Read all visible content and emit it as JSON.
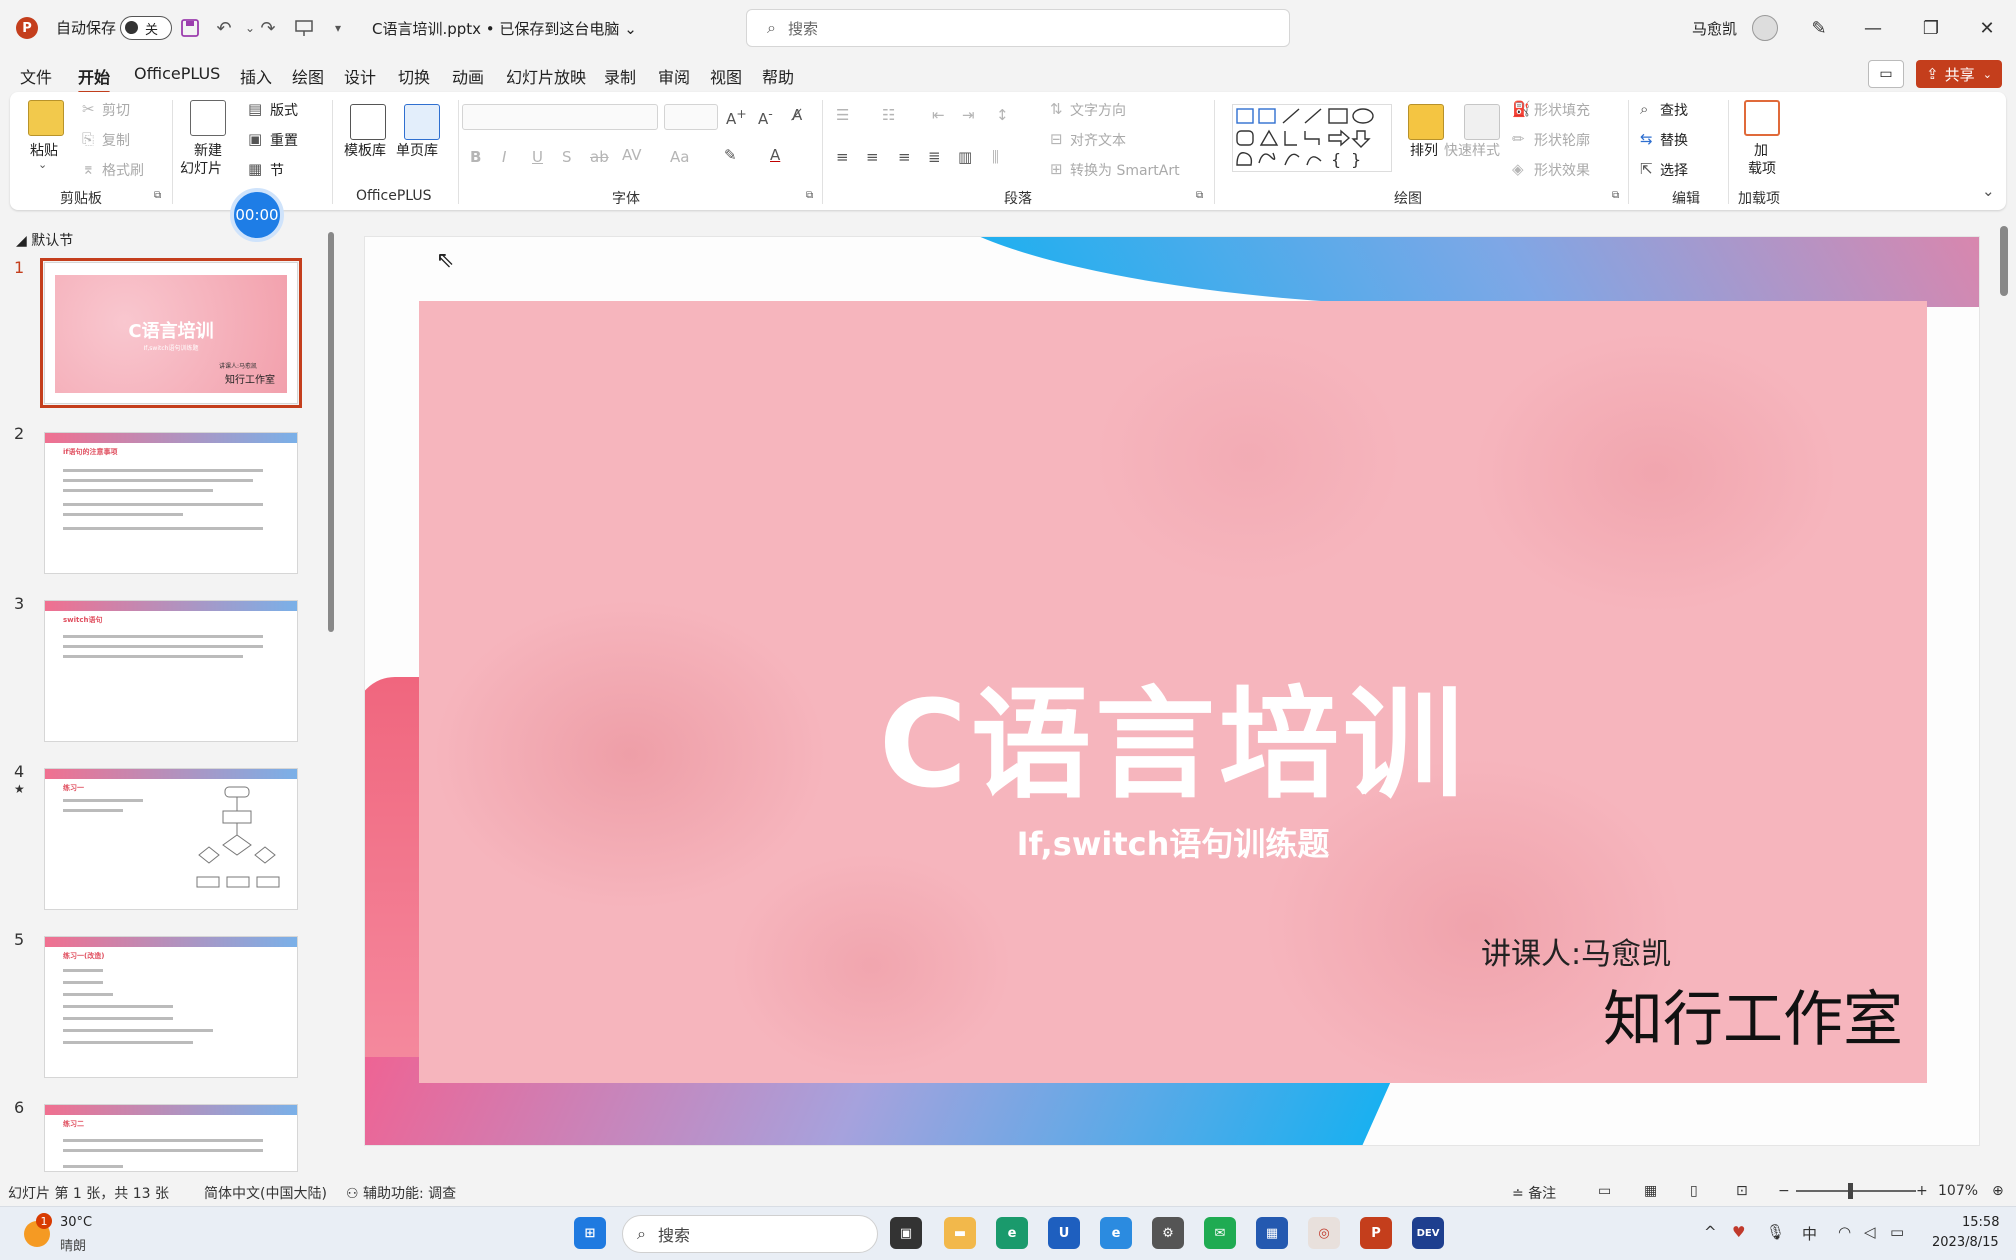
{
  "titlebar": {
    "autosave_label": "自动保存",
    "autosave_state": "关",
    "document_title": "C语言培训.pptx • 已保存到这台电脑 ⌄",
    "search_placeholder": "搜索",
    "user_name": "马愈凯"
  },
  "menu": {
    "tabs": [
      "文件",
      "开始",
      "OfficePLUS",
      "插入",
      "绘图",
      "设计",
      "切换",
      "动画",
      "幻灯片放映",
      "录制",
      "审阅",
      "视图",
      "帮助"
    ],
    "active_tab": "开始",
    "share_label": "共享"
  },
  "ribbon": {
    "clipboard": {
      "paste": "粘贴",
      "cut": "剪切",
      "copy": "复制",
      "format_painter": "格式刷",
      "label": "剪贴板"
    },
    "slides": {
      "new_slide_1": "新建",
      "new_slide_2": "幻灯片",
      "layout": "版式",
      "reset": "重置",
      "section": "节"
    },
    "officeplus": {
      "templates": "模板库",
      "single_page": "单页库",
      "label": "OfficePLUS"
    },
    "font": {
      "label": "字体"
    },
    "paragraph": {
      "text_direction": "文字方向",
      "align_text": "对齐文本",
      "smartart": "转换为 SmartArt",
      "label": "段落"
    },
    "drawing": {
      "arrange": "排列",
      "quick_styles": "快速样式",
      "shape_fill": "形状填充",
      "shape_outline": "形状轮廓",
      "shape_effects": "形状效果",
      "label": "绘图"
    },
    "editing": {
      "find": "查找",
      "replace": "替换",
      "select": "选择",
      "label": "编辑"
    },
    "addins": {
      "addins_1": "加",
      "addins_2": "载项",
      "label": "加载项"
    }
  },
  "timer": "00:00",
  "slides_panel": {
    "section_name": "默认节",
    "slides": [
      {
        "number": "1",
        "title": "C语言培训",
        "subtitle": "If,switch语句训练题",
        "small": "讲课人:马愈凯",
        "studio": "知行工作室"
      },
      {
        "number": "2",
        "title": "if语句的注意事项"
      },
      {
        "number": "3",
        "title": "switch语句"
      },
      {
        "number": "4",
        "title": "练习一"
      },
      {
        "number": "5",
        "title": "练习一(改造)"
      },
      {
        "number": "6",
        "title": "练习二"
      }
    ],
    "slide4_marker": "★"
  },
  "slide": {
    "title": "C语言培训",
    "subtitle": "If,switch语句训练题",
    "lecturer": "讲课人:马愈凯",
    "studio": "知行工作室"
  },
  "statusbar": {
    "slide_info": "幻灯片 第 1 张，共 13 张",
    "language": "简体中文(中国大陆)",
    "accessibility": "辅助功能: 调查",
    "notes": "备注",
    "zoom_level": "107%"
  },
  "taskbar": {
    "weather_badge": "1",
    "temperature": "30°C",
    "weather": "晴朗",
    "search_label": "搜索",
    "ime": "中",
    "time": "15:58",
    "date": "2023/8/15"
  },
  "colors": {
    "accent": "#c43e1c",
    "slide_pink": "#f6b5bd",
    "timer_blue": "#1e7de6"
  }
}
